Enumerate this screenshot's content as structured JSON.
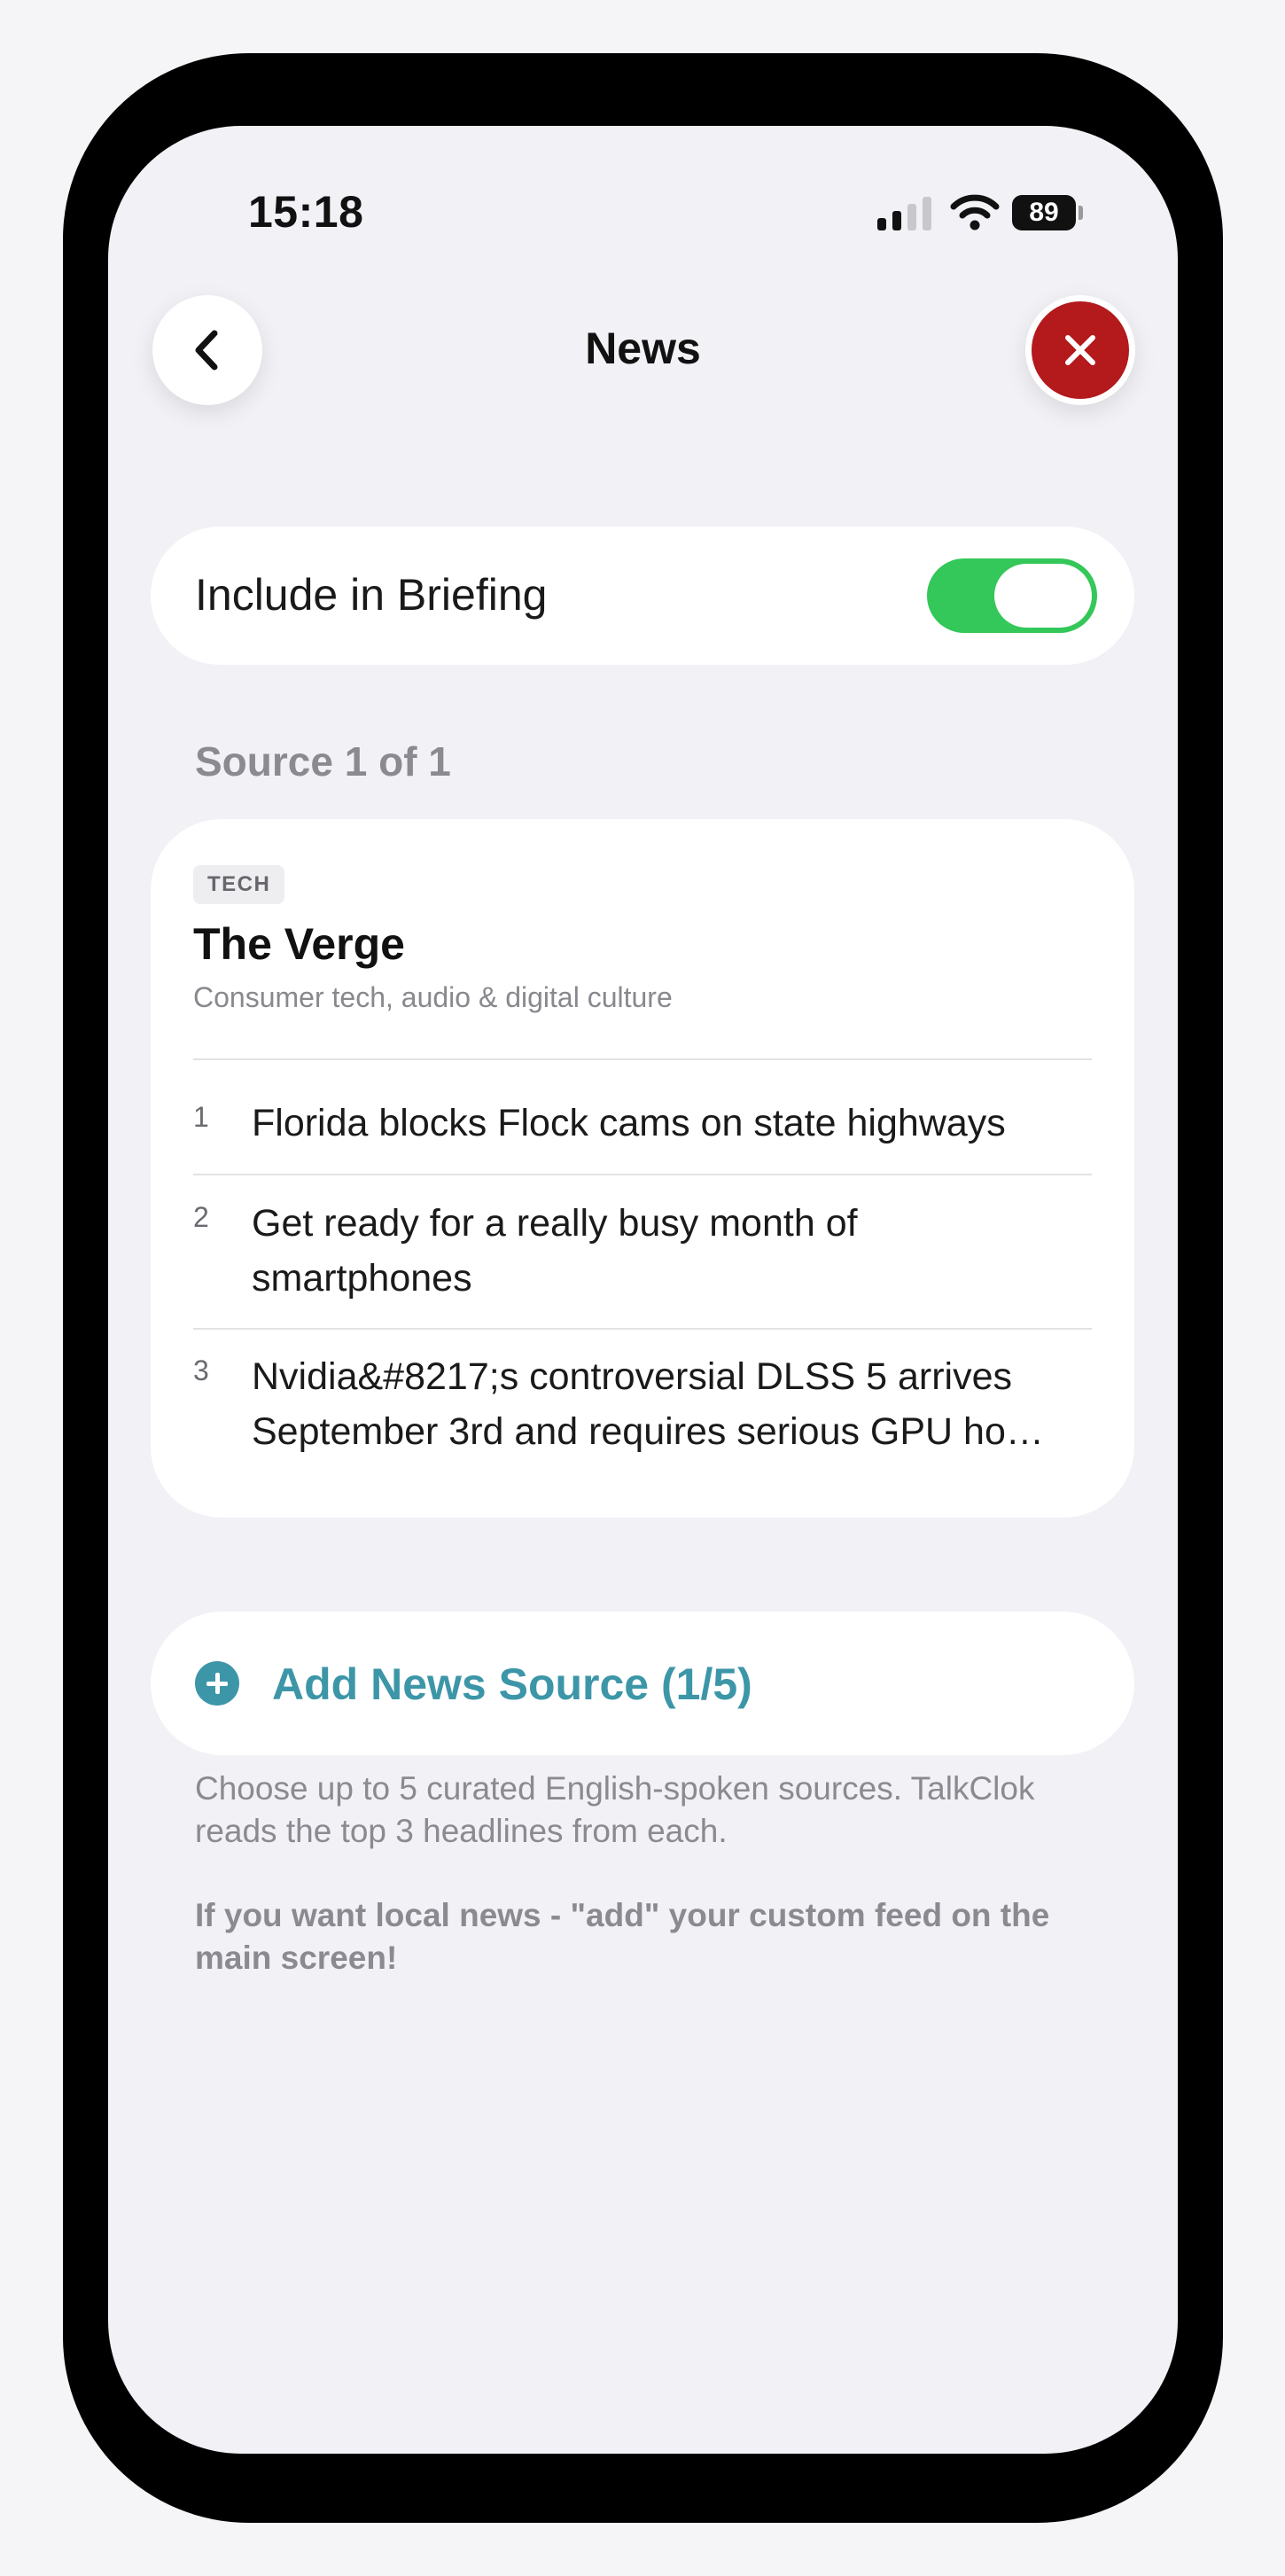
{
  "status_bar": {
    "time": "15:18",
    "battery": "89"
  },
  "nav": {
    "title": "News"
  },
  "briefing_toggle": {
    "label": "Include in Briefing",
    "on": true
  },
  "section_label": "Source 1 of 1",
  "source": {
    "tag": "TECH",
    "name": "The Verge",
    "description": "Consumer tech, audio & digital culture",
    "headlines": [
      {
        "num": "1",
        "text": "Florida blocks Flock cams on state highways"
      },
      {
        "num": "2",
        "text": "Get ready for a really busy month of smartphones"
      },
      {
        "num": "3",
        "text": "Nvidia&#8217;s controversial DLSS 5 arrives September 3rd and requires serious GPU ho…"
      }
    ]
  },
  "add_source": {
    "label": "Add News Source (1/5)"
  },
  "help": {
    "line1": "Choose up to 5 curated English-spoken sources. TalkClok reads the top 3 headlines from each.",
    "line2": "If you want local news - \"add\" your custom feed on the main screen!"
  },
  "colors": {
    "accent": "#3d96a8",
    "toggle_on": "#34c759",
    "close": "#b4191c"
  }
}
